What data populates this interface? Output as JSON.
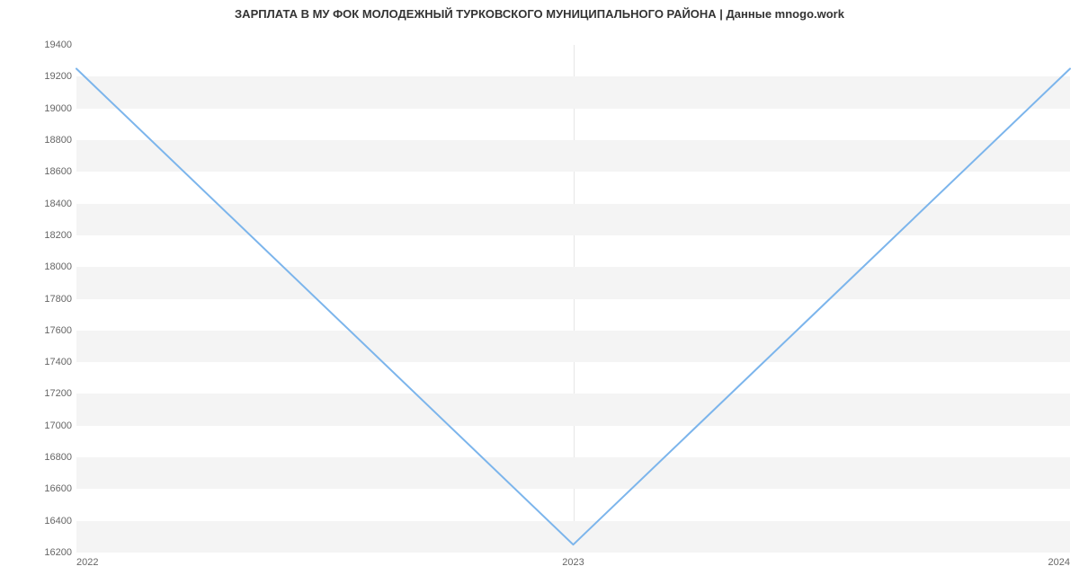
{
  "chart_data": {
    "type": "line",
    "title": "ЗАРПЛАТА В МУ ФОК  МОЛОДЕЖНЫЙ ТУРКОВСКОГО МУНИЦИПАЛЬНОГО РАЙОНА | Данные mnogo.work",
    "x": [
      "2022",
      "2023",
      "2024"
    ],
    "values": [
      19250,
      16250,
      19250
    ],
    "xlabel": "",
    "ylabel": "",
    "ylim": [
      16200,
      19400
    ],
    "y_ticks": [
      16200,
      16400,
      16600,
      16800,
      17000,
      17200,
      17400,
      17600,
      17800,
      18000,
      18200,
      18400,
      18600,
      18800,
      19000,
      19200,
      19400
    ],
    "x_ticks": [
      "2022",
      "2023",
      "2024"
    ],
    "line_color": "#7cb5ec"
  }
}
